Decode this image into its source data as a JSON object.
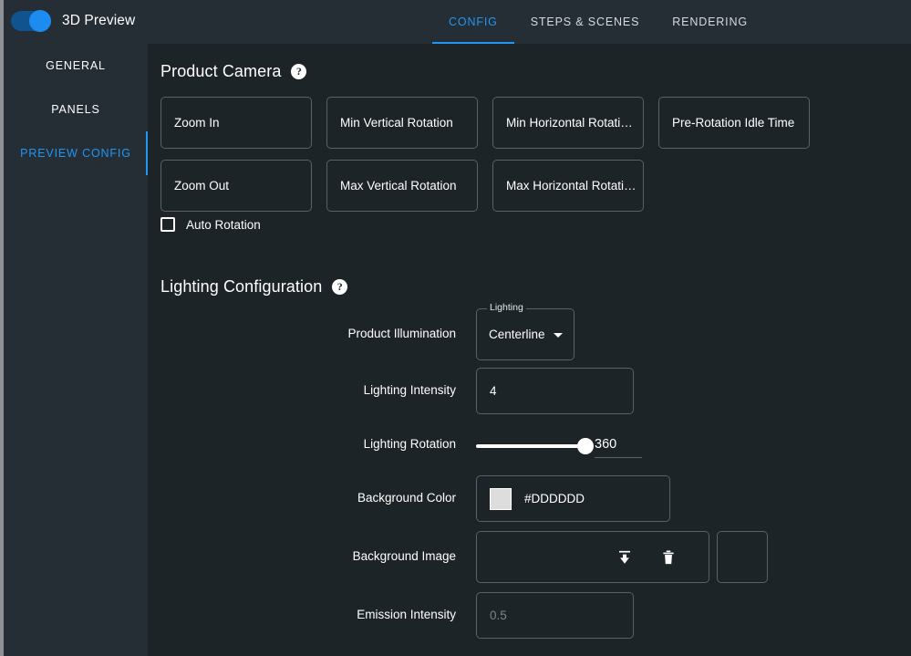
{
  "header": {
    "toggle_state": "on",
    "app_title": "3D Preview",
    "tabs": [
      {
        "label": "CONFIG",
        "active": true
      },
      {
        "label": "STEPS & SCENES",
        "active": false
      },
      {
        "label": "RENDERING",
        "active": false
      }
    ]
  },
  "sidebar": {
    "items": [
      {
        "label": "GENERAL",
        "active": false
      },
      {
        "label": "PANELS",
        "active": false
      },
      {
        "label": "PREVIEW CONFIG",
        "active": true
      }
    ]
  },
  "product_camera": {
    "title": "Product Camera",
    "help": "?",
    "buttons_row1": [
      "Zoom In",
      "Min Vertical Rotation",
      "Min Horizontal Rotati…",
      "Pre-Rotation Idle Time"
    ],
    "buttons_row2": [
      "Zoom Out",
      "Max Vertical Rotation",
      "Max Horizontal Rotati…"
    ],
    "auto_rotation": {
      "label": "Auto Rotation",
      "checked": false
    }
  },
  "lighting": {
    "title": "Lighting Configuration",
    "help": "?",
    "product_illumination": {
      "label": "Product Illumination",
      "field_label": "Lighting",
      "value": "Centerline"
    },
    "lighting_intensity": {
      "label": "Lighting Intensity",
      "value": "4"
    },
    "lighting_rotation": {
      "label": "Lighting Rotation",
      "value": "360",
      "percent": 100
    },
    "background_color": {
      "label": "Background Color",
      "value": "#DDDDDD",
      "swatch": "#DDDDDD"
    },
    "background_image": {
      "label": "Background Image",
      "upload_icon": "upload-icon",
      "delete_icon": "trash-icon"
    },
    "emission_intensity": {
      "label": "Emission Intensity",
      "value": "",
      "placeholder": "0.5"
    }
  },
  "colors": {
    "accent": "#2196f3",
    "sidebar_bg": "#252d35",
    "content_bg": "#1d2428",
    "border": "#5a6066"
  }
}
